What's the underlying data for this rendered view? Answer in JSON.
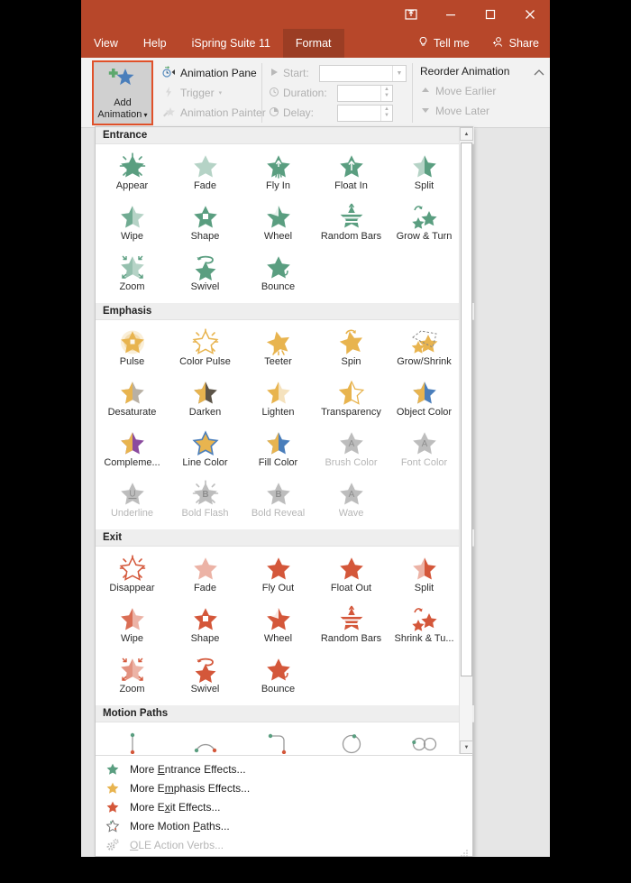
{
  "window": {
    "title_buttons": [
      {
        "name": "ribbon-display-options",
        "glyph": "ribbon"
      },
      {
        "name": "minimize",
        "glyph": "minimize"
      },
      {
        "name": "maximize",
        "glyph": "maximize"
      },
      {
        "name": "close",
        "glyph": "close"
      }
    ]
  },
  "tabs": {
    "items": [
      {
        "label": "View",
        "active": false
      },
      {
        "label": "Help",
        "active": false
      },
      {
        "label": "iSpring Suite 11",
        "active": false
      },
      {
        "label": "Format",
        "active": true
      }
    ],
    "tell_me": "Tell me",
    "share": "Share"
  },
  "ribbon": {
    "add_animation": {
      "line1": "Add",
      "line2": "Animation"
    },
    "animation_pane": "Animation Pane",
    "trigger": "Trigger",
    "animation_painter": "Animation Painter",
    "start_label": "Start:",
    "start_value": "",
    "duration_label": "Duration:",
    "duration_value": "",
    "delay_label": "Delay:",
    "delay_value": "",
    "reorder_title": "Reorder Animation",
    "move_earlier": "Move Earlier",
    "move_later": "Move Later"
  },
  "gallery": {
    "sections": [
      {
        "title": "Entrance",
        "color": "#5a9e80",
        "items": [
          {
            "label": "Appear",
            "icon": "star-burst",
            "disabled": false
          },
          {
            "label": "Fade",
            "icon": "star-fade",
            "disabled": false
          },
          {
            "label": "Fly In",
            "icon": "star-fly-in",
            "disabled": false
          },
          {
            "label": "Float In",
            "icon": "star-float-in",
            "disabled": false
          },
          {
            "label": "Split",
            "icon": "star-split",
            "disabled": false
          },
          {
            "label": "Wipe",
            "icon": "star-wipe",
            "disabled": false
          },
          {
            "label": "Shape",
            "icon": "star-shape",
            "disabled": false
          },
          {
            "label": "Wheel",
            "icon": "star-wheel",
            "disabled": false
          },
          {
            "label": "Random Bars",
            "icon": "star-bars",
            "disabled": false
          },
          {
            "label": "Grow & Turn",
            "icon": "star-grow-turn",
            "disabled": false
          },
          {
            "label": "Zoom",
            "icon": "star-zoom",
            "disabled": false
          },
          {
            "label": "Swivel",
            "icon": "star-swivel",
            "disabled": false
          },
          {
            "label": "Bounce",
            "icon": "star-bounce",
            "disabled": false
          }
        ]
      },
      {
        "title": "Emphasis",
        "color": "#e8b44f",
        "items": [
          {
            "label": "Pulse",
            "icon": "star-glow",
            "disabled": false
          },
          {
            "label": "Color Pulse",
            "icon": "star-outline-burst",
            "disabled": false
          },
          {
            "label": "Teeter",
            "icon": "star-teeter",
            "disabled": false
          },
          {
            "label": "Spin",
            "icon": "star-spin",
            "disabled": false
          },
          {
            "label": "Grow/Shrink",
            "icon": "star-grow-shrink",
            "disabled": false
          },
          {
            "label": "Desaturate",
            "icon": "star-half-gray",
            "disabled": false
          },
          {
            "label": "Darken",
            "icon": "star-half-dark",
            "disabled": false
          },
          {
            "label": "Lighten",
            "icon": "star-half-light",
            "disabled": false
          },
          {
            "label": "Transparency",
            "icon": "star-half-transparent",
            "disabled": false
          },
          {
            "label": "Object Color",
            "icon": "star-half-blue",
            "disabled": false
          },
          {
            "label": "Compleme...",
            "icon": "star-half-purple",
            "disabled": false
          },
          {
            "label": "Line Color",
            "icon": "star-line-color",
            "disabled": false
          },
          {
            "label": "Fill Color",
            "icon": "star-fill-color",
            "disabled": false
          },
          {
            "label": "Brush Color",
            "icon": "star-letter-a",
            "disabled": true
          },
          {
            "label": "Font Color",
            "icon": "star-letter-a",
            "disabled": true
          },
          {
            "label": "Underline",
            "icon": "star-letter-u",
            "disabled": true
          },
          {
            "label": "Bold Flash",
            "icon": "star-letter-b-burst",
            "disabled": true
          },
          {
            "label": "Bold Reveal",
            "icon": "star-letter-b",
            "disabled": true
          },
          {
            "label": "Wave",
            "icon": "star-letter-a",
            "disabled": true
          }
        ]
      },
      {
        "title": "Exit",
        "color": "#d4573a",
        "items": [
          {
            "label": "Disappear",
            "icon": "star-outline-burst",
            "disabled": false
          },
          {
            "label": "Fade",
            "icon": "star-fade",
            "disabled": false
          },
          {
            "label": "Fly Out",
            "icon": "star-fly-out",
            "disabled": false
          },
          {
            "label": "Float Out",
            "icon": "star-float-out",
            "disabled": false
          },
          {
            "label": "Split",
            "icon": "star-split",
            "disabled": false
          },
          {
            "label": "Wipe",
            "icon": "star-wipe",
            "disabled": false
          },
          {
            "label": "Shape",
            "icon": "star-shape",
            "disabled": false
          },
          {
            "label": "Wheel",
            "icon": "star-wheel",
            "disabled": false
          },
          {
            "label": "Random Bars",
            "icon": "star-bars",
            "disabled": false
          },
          {
            "label": "Shrink & Tu...",
            "icon": "star-grow-turn",
            "disabled": false
          },
          {
            "label": "Zoom",
            "icon": "star-zoom",
            "disabled": false
          },
          {
            "label": "Swivel",
            "icon": "star-swivel",
            "disabled": false
          },
          {
            "label": "Bounce",
            "icon": "star-bounce",
            "disabled": false
          }
        ]
      },
      {
        "title": "Motion Paths",
        "color": "#8a8a8a",
        "items": [
          {
            "label": "Lines",
            "icon": "path-lines",
            "disabled": false
          },
          {
            "label": "Arcs",
            "icon": "path-arcs",
            "disabled": false
          },
          {
            "label": "Turns",
            "icon": "path-turns",
            "disabled": false
          },
          {
            "label": "Shapes",
            "icon": "path-shapes",
            "disabled": false
          },
          {
            "label": "Loops",
            "icon": "path-loops",
            "disabled": false
          }
        ]
      }
    ],
    "menu_items": [
      {
        "pre": "More ",
        "accel": "E",
        "post": "ntrance Effects...",
        "icon": "star-green",
        "disabled": false
      },
      {
        "pre": "More E",
        "accel": "m",
        "post": "phasis Effects...",
        "icon": "star-gold",
        "disabled": false
      },
      {
        "pre": "More E",
        "accel": "x",
        "post": "it Effects...",
        "icon": "star-red",
        "disabled": false
      },
      {
        "pre": "More Motion ",
        "accel": "P",
        "post": "aths...",
        "icon": "star-path",
        "disabled": false
      },
      {
        "pre": "",
        "accel": "O",
        "post": "LE Action Verbs...",
        "icon": "gears",
        "disabled": true
      }
    ]
  },
  "colors": {
    "titlebar": "#b7472a",
    "tab_active": "#9b3d24",
    "entrance": "#5a9e80",
    "emphasis": "#e8b44f",
    "exit": "#d4573a",
    "accent_blue": "#4a7ebb",
    "highlight_border": "#e0512a",
    "disabled_gray": "#b6b6b6"
  }
}
